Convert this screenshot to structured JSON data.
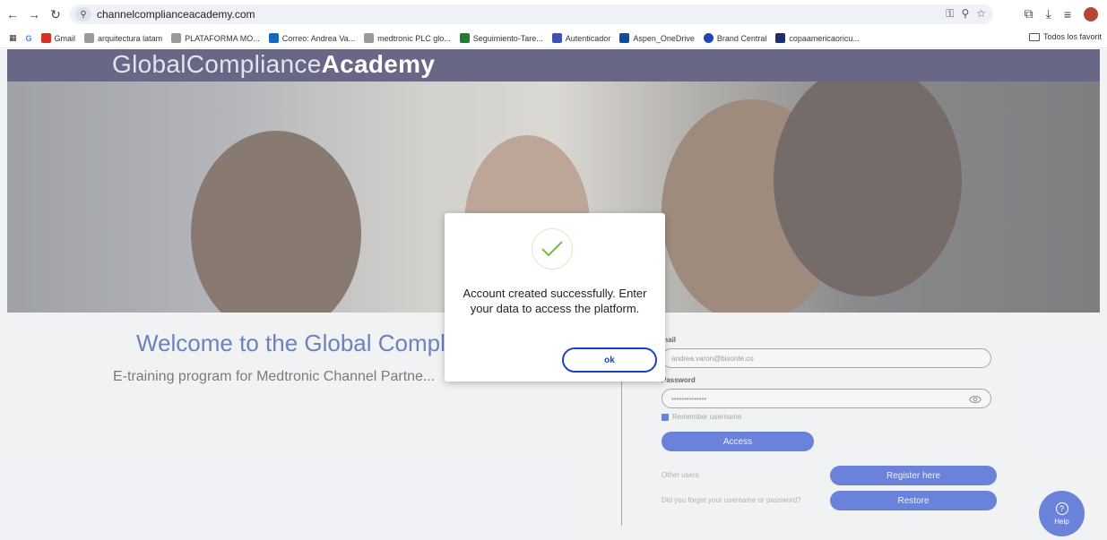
{
  "browser": {
    "url": "channelcomplianceacademy.com",
    "bookmarks": [
      {
        "label": "Gmail",
        "color": "#d93025"
      },
      {
        "label": "arquitectura latam",
        "color": "#7b7b7b"
      },
      {
        "label": "PLATAFORMA MO...",
        "color": "#7b7b7b"
      },
      {
        "label": "Correo: Andrea Va...",
        "color": "#0f6cbd"
      },
      {
        "label": "medtronic PLC glo...",
        "color": "#7b7b7b"
      },
      {
        "label": "Seguimiento-Tare...",
        "color": "#1e7e34"
      },
      {
        "label": "Autenticador",
        "color": "#3f51b5"
      },
      {
        "label": "Aspen_OneDrive",
        "color": "#0a4ea3"
      },
      {
        "label": "Brand Central",
        "color": "#2444b8"
      },
      {
        "label": "copaamericaoricu...",
        "color": "#1c2e6b"
      }
    ],
    "favorites_label": "Todos los favorit"
  },
  "brand": {
    "light": "GlobalCompliance",
    "bold": "Academy"
  },
  "hero": {
    "welcome": "Welcome to the Global Compli",
    "subtitle": "E-training program for Medtronic Channel Partne..."
  },
  "login": {
    "email_label": "mail",
    "email_value": "andrea.varon@bisonte.co",
    "password_label": "Password",
    "password_value": "••••••••••••••",
    "remember_label": "Remember username",
    "access_label": "Access",
    "other_users_label": "Other users",
    "register_label": "Register here",
    "forgot_label": "Did you forget your username or password?",
    "restore_label": "Restore"
  },
  "help": {
    "label": "Help"
  },
  "modal": {
    "message": "Account created successfully. Enter your data to access the platform.",
    "ok_label": "ok"
  },
  "colors": {
    "navy": "#171845",
    "accent": "#1b3fc7",
    "success": "#6fbf3a"
  }
}
